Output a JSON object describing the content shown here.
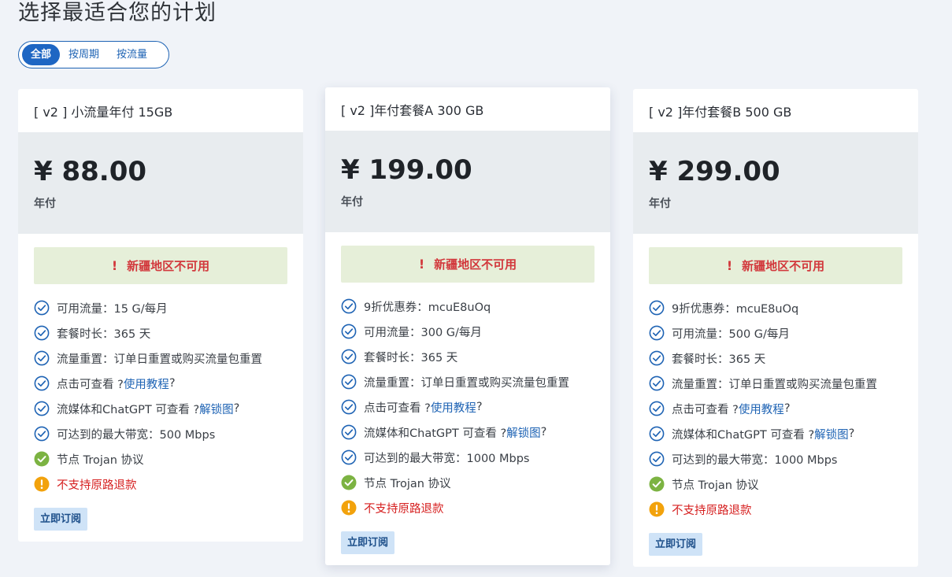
{
  "page": {
    "title": "选择最适合您的计划"
  },
  "filter": {
    "options": [
      "全部",
      "按周期",
      "按流量"
    ]
  },
  "alert_text": "新疆地区不可用",
  "alert_mark": "!",
  "subscribe_label": "立即订阅",
  "colors": {
    "accent": "#1e66c3",
    "check_ok": "#7cb342",
    "warn": "#f2a20c",
    "alert_red": "#d2383c"
  },
  "plans": [
    {
      "name": "[ v2 ] 小流量年付 15GB",
      "price": "¥ 88.00",
      "period": "年付",
      "features": [
        {
          "icon": "check-circle-icon",
          "text": "可用流量：15 G/每月"
        },
        {
          "icon": "check-circle-icon",
          "text": "套餐时长：365 天"
        },
        {
          "icon": "check-circle-icon",
          "text": "流量重置：订单日重置或购买流量包重置"
        },
        {
          "icon": "check-circle-icon",
          "pre": "点击可查看 ?",
          "link": "使用教程",
          "post": "?"
        },
        {
          "icon": "check-circle-icon",
          "pre": "流媒体和ChatGPT 可查看 ?",
          "link": "解锁图",
          "post": "?"
        },
        {
          "icon": "check-circle-icon",
          "text": "可达到的最大带宽：500 Mbps"
        },
        {
          "icon": "check-filled-icon",
          "text": "节点 Trojan 协议"
        },
        {
          "icon": "warning-icon",
          "text": "不支持原路退款"
        }
      ]
    },
    {
      "name": "[ v2 ]年付套餐A 300 GB",
      "price": "¥ 199.00",
      "period": "年付",
      "features": [
        {
          "icon": "check-circle-icon",
          "text": "9折优惠券：mcuE8uOq"
        },
        {
          "icon": "check-circle-icon",
          "text": "可用流量：300 G/每月"
        },
        {
          "icon": "check-circle-icon",
          "text": "套餐时长：365 天"
        },
        {
          "icon": "check-circle-icon",
          "text": "流量重置：订单日重置或购买流量包重置"
        },
        {
          "icon": "check-circle-icon",
          "pre": "点击可查看 ?",
          "link": "使用教程",
          "post": "?"
        },
        {
          "icon": "check-circle-icon",
          "pre": "流媒体和ChatGPT 可查看 ?",
          "link": "解锁图",
          "post": "?"
        },
        {
          "icon": "check-circle-icon",
          "text": "可达到的最大带宽：1000 Mbps"
        },
        {
          "icon": "check-filled-icon",
          "text": "节点 Trojan 协议"
        },
        {
          "icon": "warning-icon",
          "text": "不支持原路退款"
        }
      ]
    },
    {
      "name": "[ v2 ]年付套餐B 500 GB",
      "price": "¥ 299.00",
      "period": "年付",
      "features": [
        {
          "icon": "check-circle-icon",
          "text": "9折优惠券：mcuE8uOq"
        },
        {
          "icon": "check-circle-icon",
          "text": "可用流量：500 G/每月"
        },
        {
          "icon": "check-circle-icon",
          "text": "套餐时长：365 天"
        },
        {
          "icon": "check-circle-icon",
          "text": "流量重置：订单日重置或购买流量包重置"
        },
        {
          "icon": "check-circle-icon",
          "pre": "点击可查看 ?",
          "link": "使用教程",
          "post": "?"
        },
        {
          "icon": "check-circle-icon",
          "pre": "流媒体和ChatGPT 可查看 ?",
          "link": "解锁图",
          "post": "?"
        },
        {
          "icon": "check-circle-icon",
          "text": "可达到的最大带宽：1000 Mbps"
        },
        {
          "icon": "check-filled-icon",
          "text": "节点 Trojan 协议"
        },
        {
          "icon": "warning-icon",
          "text": "不支持原路退款"
        }
      ]
    }
  ]
}
